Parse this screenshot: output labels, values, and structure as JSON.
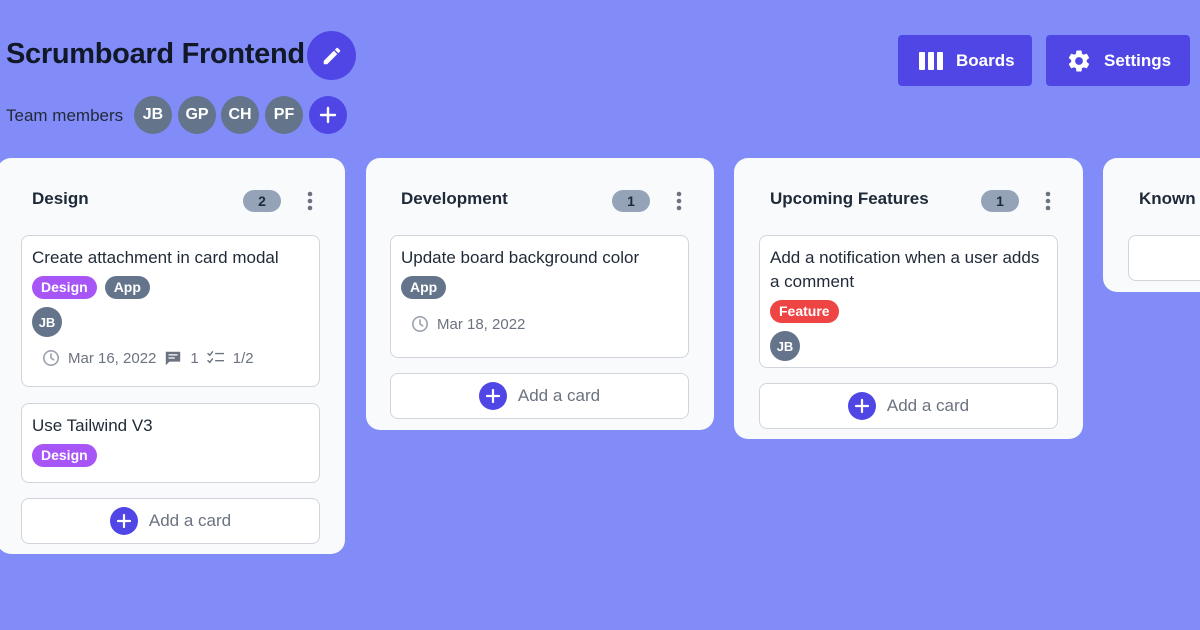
{
  "header": {
    "title": "Scrumboard Frontend",
    "team_label": "Team members",
    "members": [
      "JB",
      "GP",
      "CH",
      "PF"
    ],
    "boards_label": "Boards",
    "settings_label": "Settings"
  },
  "columns": [
    {
      "name": "Design",
      "count": "2",
      "cards": [
        {
          "title": "Create attachment in card modal",
          "tags": [
            "Design",
            "App"
          ],
          "member": "JB",
          "date": "Mar 16, 2022",
          "comments": "1",
          "checklist": "1/2"
        },
        {
          "title": "Use Tailwind V3",
          "tags": [
            "Design"
          ]
        }
      ],
      "add_label": "Add a card"
    },
    {
      "name": "Development",
      "count": "1",
      "cards": [
        {
          "title": "Update board background color",
          "tags": [
            "App"
          ],
          "date": "Mar 18, 2022"
        }
      ],
      "add_label": "Add a card"
    },
    {
      "name": "Upcoming Features",
      "count": "1",
      "cards": [
        {
          "title": "Add a notification when a user adds a comment",
          "tags": [
            "Feature"
          ],
          "member": "JB"
        }
      ],
      "add_label": "Add a card"
    },
    {
      "name": "Known Bugs"
    }
  ],
  "colors": {
    "background": "#818cf8",
    "accent": "#4f46e5",
    "tag_design": "#a855f7",
    "tag_app": "#64748b",
    "tag_feature": "#ef4444"
  },
  "icons": [
    "edit-icon",
    "boards-icon",
    "settings-icon",
    "plus-icon",
    "more-vert-icon",
    "clock-icon",
    "comment-icon",
    "checklist-icon"
  ]
}
